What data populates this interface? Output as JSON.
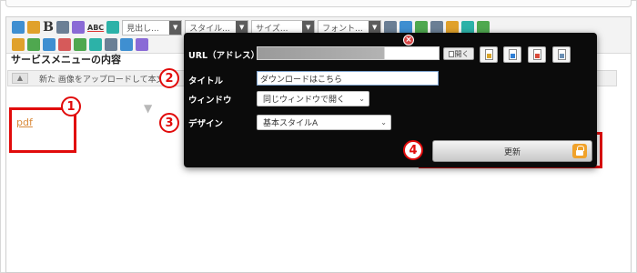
{
  "toolbar": {
    "bold_label": "B",
    "abc_label": "ABC",
    "heading_select": "見出し...",
    "style_select": "スタイル...",
    "size_select": "サイズ...",
    "font_select": "フォント...",
    "dropdown_arrow": "▼"
  },
  "content": {
    "section_title": "サービスメニューの内容",
    "upload_hint": "新た 画像をアップロードして本文に",
    "upload_arrow": "▲",
    "drop_arrow": "▼",
    "pdf_link": "pdf"
  },
  "dialog": {
    "url_label": "URL（アドレス）",
    "open_button": "開く",
    "title_label": "タイトル",
    "title_value": "ダウンロードはこちら",
    "window_label": "ウィンドウ",
    "window_value": "同じウィンドウで開く",
    "design_label": "デザイン",
    "design_value": "基本スタイルA",
    "update_button": "更新",
    "close_symbol": "×",
    "chevron": "⌄"
  },
  "annotations": {
    "n1": "1",
    "n2": "2",
    "n3": "3",
    "n4": "4"
  },
  "colors": {
    "annotation_red": "#e10b0b",
    "dialog_bg": "#0b0b0b",
    "link_orange": "#d98a3a"
  }
}
